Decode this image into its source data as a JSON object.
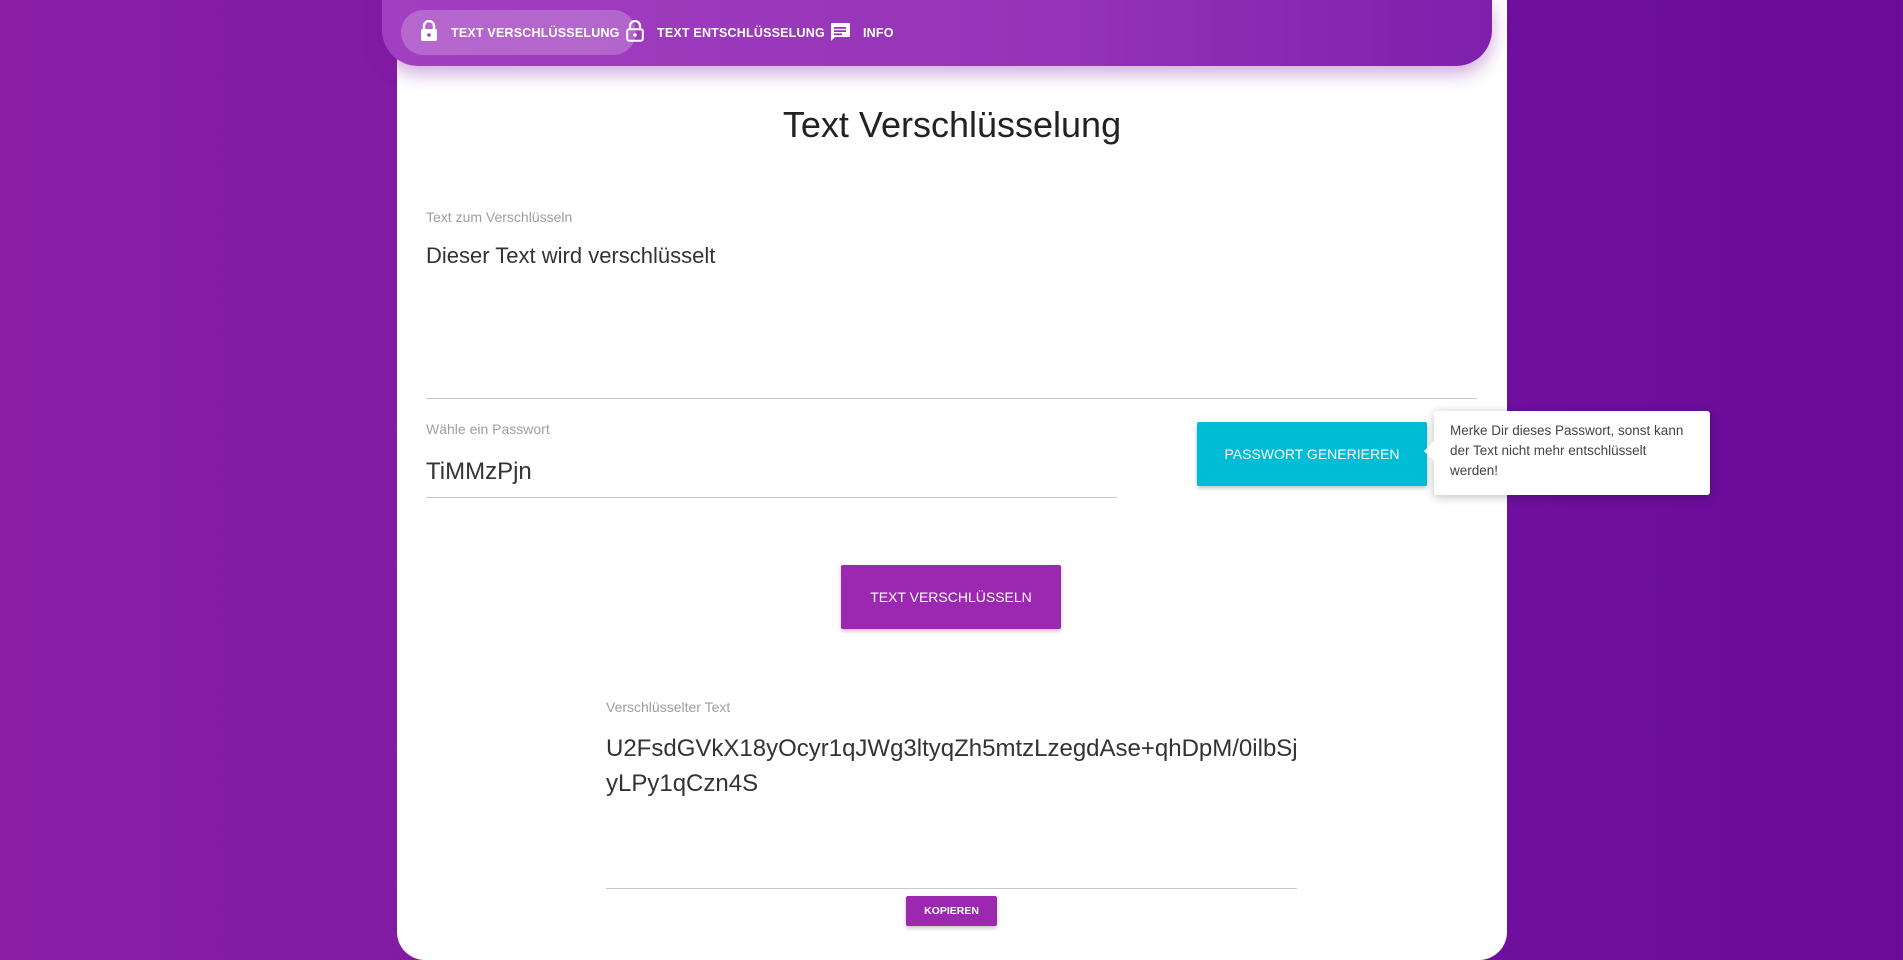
{
  "nav": {
    "tabs": [
      {
        "label": "TEXT VERSCHLÜSSELUNG",
        "icon": "lock-icon",
        "active": true
      },
      {
        "label": "TEXT ENTSCHLÜSSELUNG",
        "icon": "lock-open-icon",
        "active": false
      },
      {
        "label": "INFO",
        "icon": "message-icon",
        "active": false
      }
    ]
  },
  "page": {
    "title": "Text Verschlüsselung"
  },
  "encrypt": {
    "text_label": "Text zum Verschlüsseln",
    "text_value": "Dieser Text wird verschlüsselt",
    "password_label": "Wähle ein Passwort",
    "password_value": "TiMMzPjn",
    "generate_button": "Passwort generieren",
    "tooltip": "Merke Dir dieses Passwort, sonst kann der Text nicht mehr entschlüsselt werden!",
    "encrypt_button": "Text verschlüsseln",
    "result_label": "Verschlüsselter Text",
    "result_value": "U2FsdGVkX18yOcyr1qJWg3ltyqZh5mtzLzegdAse+qhDpM/0ilbSjyLPy1qCzn4S",
    "copy_button": "Kopieren"
  },
  "colors": {
    "background": "#7a18a0",
    "nav": "#9534b8",
    "primary_button": "#9c27b0",
    "generate_button": "#00bcd4"
  }
}
